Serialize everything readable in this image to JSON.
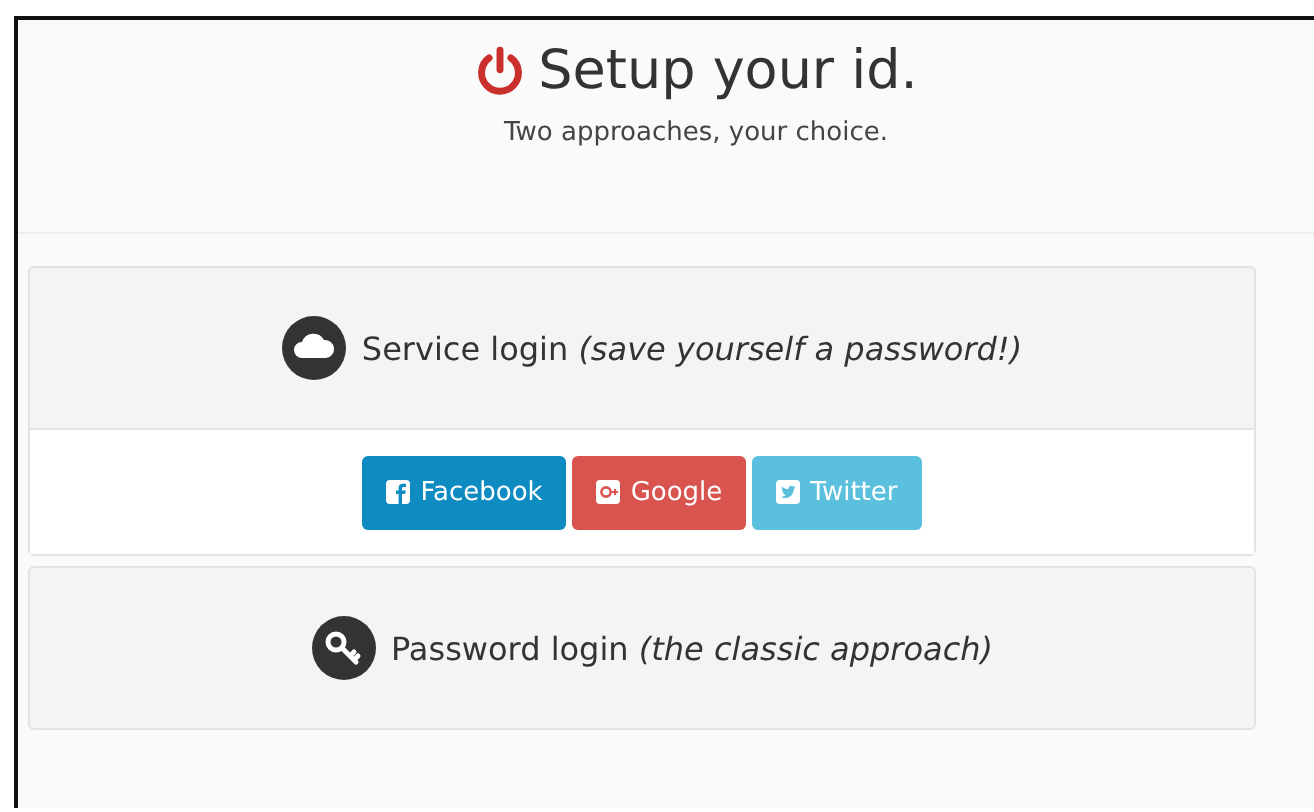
{
  "header": {
    "title": "Setup your id.",
    "subtitle": "Two approaches, your choice."
  },
  "panels": [
    {
      "kind": "service",
      "heading": "Service login *(save yourself a password!)*",
      "buttons": [
        {
          "kind": "facebook",
          "label": "Facebook",
          "color": "#0e8bc0"
        },
        {
          "kind": "google",
          "label": "Google",
          "color": "#d9534f"
        },
        {
          "kind": "twitter",
          "label": "Twitter",
          "color": "#5bc0de"
        }
      ]
    },
    {
      "kind": "password",
      "heading": "Password login *(the classic approach)*"
    }
  ]
}
